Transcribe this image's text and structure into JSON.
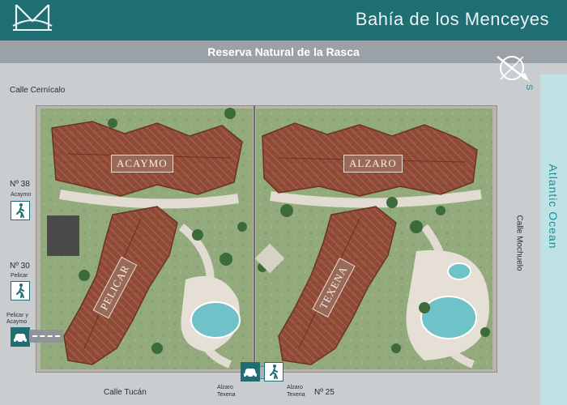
{
  "header": {
    "title": "Bahía de los Menceyes",
    "logo_icon": "m-bridge-logo-icon",
    "bg_color": "#1f6e73"
  },
  "reserve": {
    "label": "Reserva Natural de la Rasca"
  },
  "compass": {
    "icon": "compass-icon",
    "letter": "S"
  },
  "ocean": {
    "label": "Atlantic Ocean",
    "color": "#bfe3e4"
  },
  "streets": {
    "top": "Calle Cernícalo",
    "right": "Calle Mochuelo",
    "bottom": "Calle Tucán"
  },
  "buildings": {
    "acaymo": "ACAYMO",
    "alzaro": "ALZARO",
    "pelicar": "PELICAR",
    "texena": "TEXENA"
  },
  "entrances": {
    "n38": {
      "number": "Nº 38",
      "name": "Acaymo",
      "icon": "pedestrian-icon"
    },
    "n30": {
      "number": "Nº 30",
      "name": "Pelicar",
      "icon": "pedestrian-icon"
    },
    "parking_left": {
      "line1": "Pelicar y",
      "line2": "Acaymo",
      "icon": "car-icon"
    },
    "parking_bottom": {
      "line1": "Alzaro",
      "line2": "Texena",
      "icon": "car-icon"
    },
    "walk_bottom": {
      "line1": "Alzaro",
      "line2": "Texena",
      "icon": "pedestrian-icon"
    },
    "n25": {
      "number": "Nº 25"
    }
  },
  "colors": {
    "roof": "#8d4a36",
    "garden": "#8fa67a",
    "pool": "#6fc2c8",
    "path": "#d9d3cc"
  }
}
